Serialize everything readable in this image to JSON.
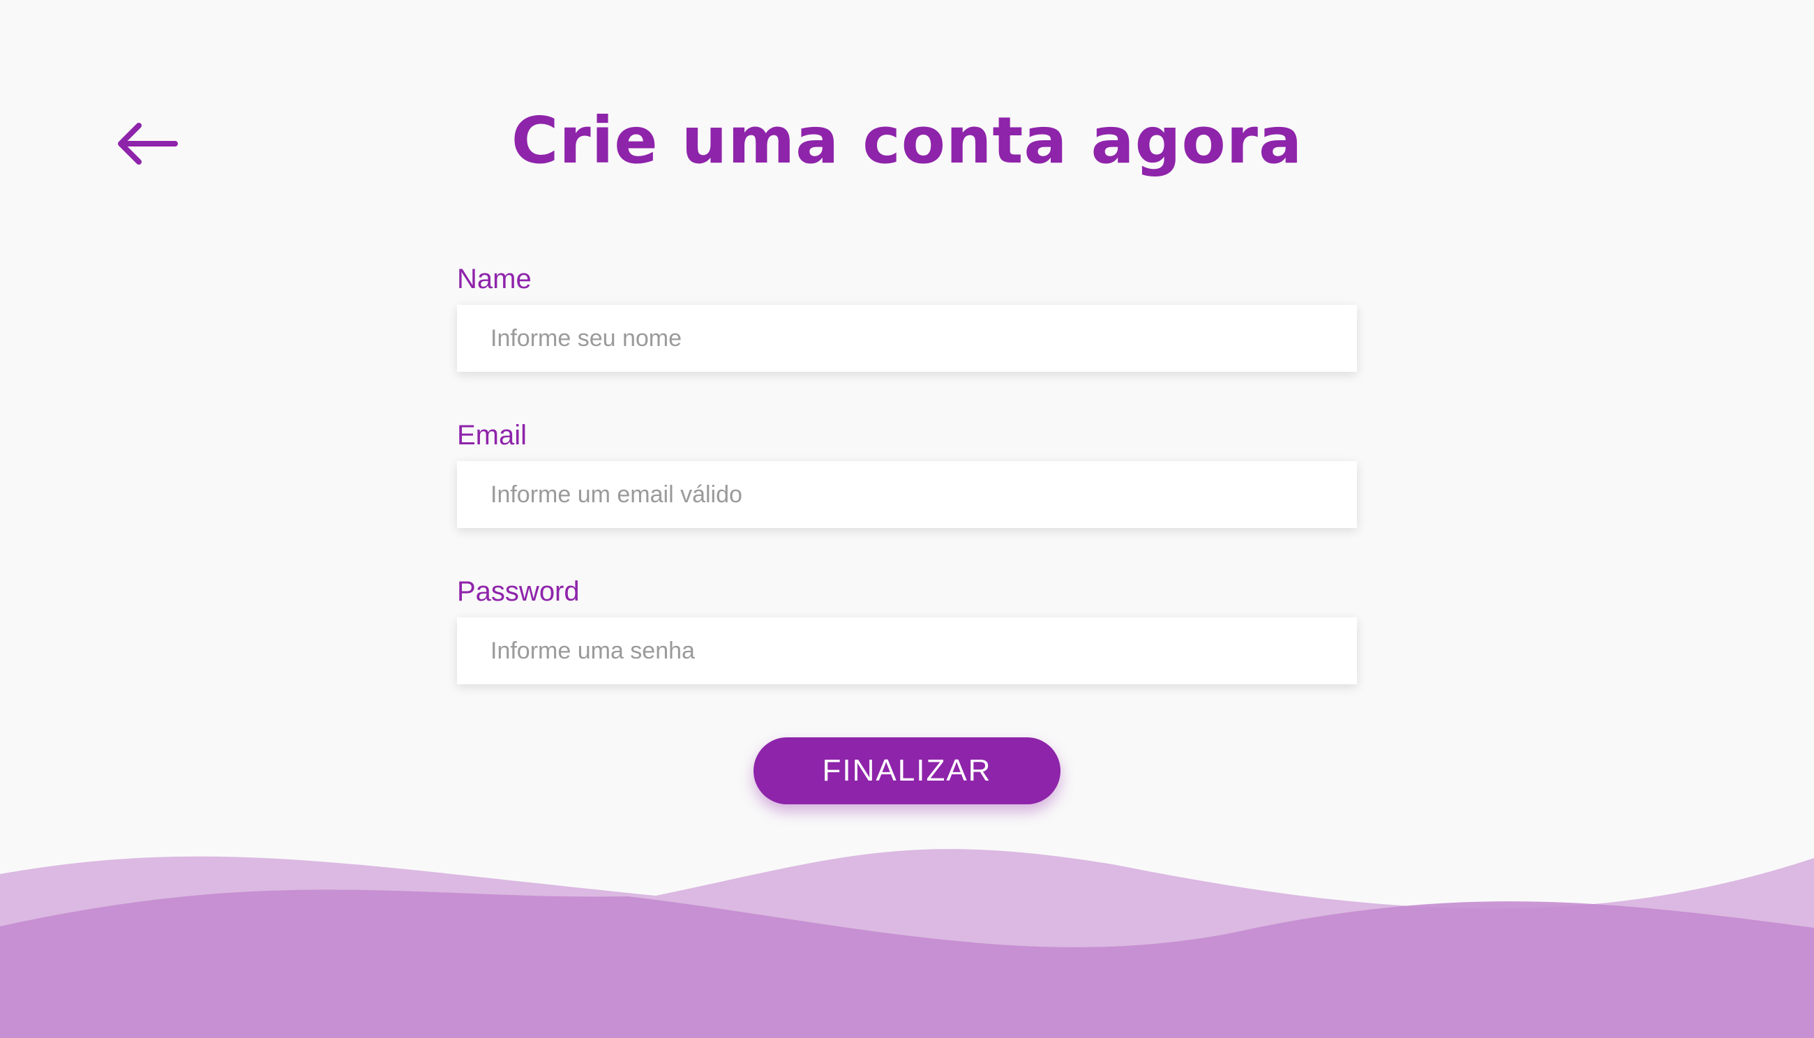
{
  "header": {
    "title": "Crie uma conta agora",
    "back_icon": "arrow-left-icon"
  },
  "form": {
    "name": {
      "label": "Name",
      "placeholder": "Informe seu nome",
      "value": ""
    },
    "email": {
      "label": "Email",
      "placeholder": "Informe um email válido",
      "value": ""
    },
    "password": {
      "label": "Password",
      "placeholder": "Informe uma senha",
      "value": ""
    },
    "submit_label": "FINALIZAR"
  },
  "colors": {
    "accent": "#8e24aa",
    "background": "#f9f9f9",
    "wave_light": "#dbb9e2",
    "wave_dark": "#c48cd0"
  }
}
